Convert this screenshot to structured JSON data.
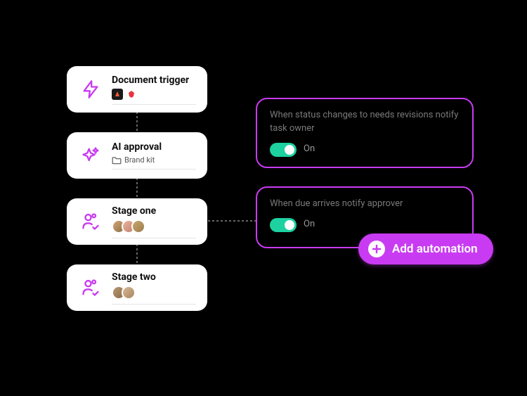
{
  "stages": [
    {
      "title": "Document trigger",
      "meta_type": "apps"
    },
    {
      "title": "AI approval",
      "meta_type": "folder",
      "meta_label": "Brand kit"
    },
    {
      "title": "Stage one",
      "meta_type": "avatars3"
    },
    {
      "title": "Stage two",
      "meta_type": "avatars2"
    }
  ],
  "automations": [
    {
      "desc": "When status changes to needs revisions notify task owner",
      "state": "On"
    },
    {
      "desc": "When due arrives notify approver",
      "state": "On"
    }
  ],
  "add_button": "Add automation",
  "colors": {
    "accent": "#c93bf2",
    "toggle_on": "#1dd1a1"
  }
}
